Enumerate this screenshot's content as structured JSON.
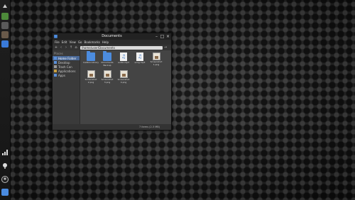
{
  "window": {
    "title": "Documents",
    "menu": [
      "File",
      "Edit",
      "View",
      "Go",
      "Bookmarks",
      "Help"
    ],
    "path": "/home/user/Documents",
    "status": "7 items (2.3 MB)"
  },
  "sidebar": {
    "heading": "Places",
    "items": [
      {
        "label": "Home Folder",
        "selected": true
      },
      {
        "label": "Desktop",
        "selected": false
      },
      {
        "label": "Trash Can",
        "selected": false
      },
      {
        "label": "Applications",
        "selected": false
      },
      {
        "label": "Apps",
        "selected": false
      }
    ]
  },
  "files": [
    {
      "name": "Calibre Library",
      "icon": "folder-icon"
    },
    {
      "name": "Documents Backup",
      "icon": "folder-icon"
    },
    {
      "name": "audio.mp3",
      "icon": "audio-file-icon"
    },
    {
      "name": "song.mp3",
      "icon": "audio-file-icon"
    },
    {
      "name": "Screenshot 1.png",
      "icon": "image-file-icon"
    },
    {
      "name": "Screenshot 2.png",
      "icon": "image-file-icon"
    },
    {
      "name": "Screenshot 3.png",
      "icon": "image-file-icon"
    },
    {
      "name": "Screenshot 4.png",
      "icon": "image-file-icon"
    }
  ],
  "colors": {
    "accent": "#4c8cdf",
    "window_bg": "#3c3c3c",
    "dock_bg": "#1f1f1f"
  }
}
